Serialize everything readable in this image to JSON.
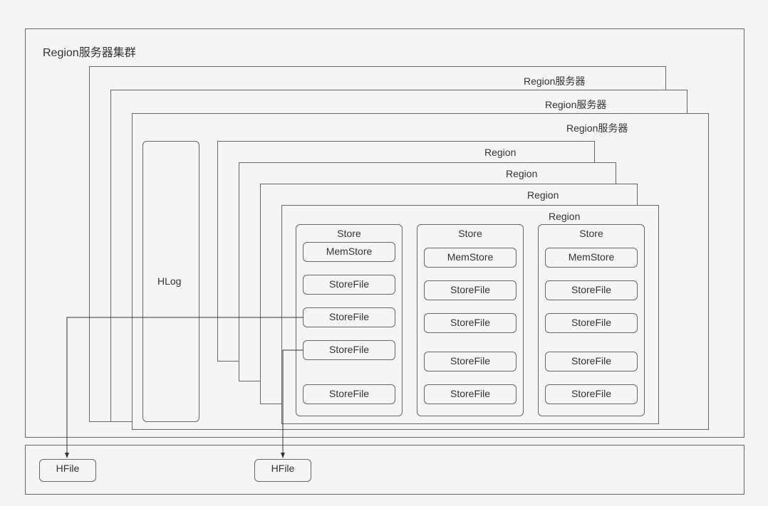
{
  "cluster": {
    "title": "Region服务器集群"
  },
  "regionServers": {
    "server1": "Region服务器",
    "server2": "Region服务器",
    "server3": "Region服务器"
  },
  "hlog": {
    "label": "HLog"
  },
  "regions": {
    "region1": "Region",
    "region2": "Region",
    "region3": "Region",
    "region4": "Region"
  },
  "stores": {
    "store1": {
      "label": "Store",
      "memstore": "MemStore",
      "sf1": "StoreFile",
      "sf2": "StoreFile",
      "sf3": "StoreFile",
      "sf4": "StoreFile"
    },
    "store2": {
      "label": "Store",
      "memstore": "MemStore",
      "sf1": "StoreFile",
      "sf2": "StoreFile",
      "sf3": "StoreFile",
      "sf4": "StoreFile"
    },
    "store3": {
      "label": "Store",
      "memstore": "MemStore",
      "sf1": "StoreFile",
      "sf2": "StoreFile",
      "sf3": "StoreFile",
      "sf4": "StoreFile"
    }
  },
  "hfiles": {
    "hfile1": "HFile",
    "hfile2": "HFile"
  }
}
